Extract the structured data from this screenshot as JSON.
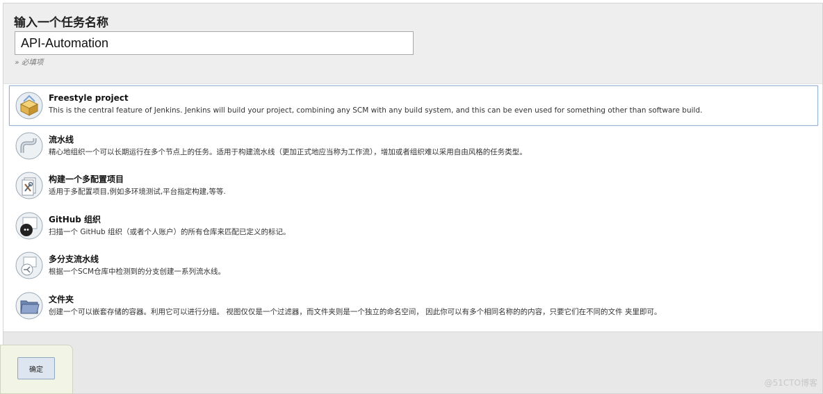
{
  "header": {
    "title": "输入一个任务名称",
    "input_value": "API-Automation",
    "required_hint": "» 必填项"
  },
  "items": [
    {
      "title": "Freestyle project",
      "description": "This is the central feature of Jenkins. Jenkins will build your project, combining any SCM with any build system, and this can be even used for something other than software build.",
      "icon": "freestyle-box-icon",
      "selected": true
    },
    {
      "title": "流水线",
      "description": "精心地组织一个可以长期运行在多个节点上的任务。适用于构建流水线（更加正式地应当称为工作流），增加或者组织难以采用自由风格的任务类型。",
      "icon": "pipeline-icon",
      "selected": false
    },
    {
      "title": "构建一个多配置项目",
      "description": "适用于多配置项目,例如多环境测试,平台指定构建,等等.",
      "icon": "multi-config-icon",
      "selected": false
    },
    {
      "title": "GitHub 组织",
      "description": "扫描一个 GitHub 组织（或者个人账户）的所有仓库来匹配已定义的标记。",
      "icon": "github-icon",
      "selected": false
    },
    {
      "title": "多分支流水线",
      "description": "根据一个SCM仓库中检测到的分支创建一系列流水线。",
      "icon": "multibranch-icon",
      "selected": false
    },
    {
      "title": "文件夹",
      "description": "创建一个可以嵌套存储的容器。利用它可以进行分组。 视图仅仅是一个过滤器，而文件夹则是一个独立的命名空间， 因此你可以有多个相同名称的的内容，只要它们在不同的文件 夹里即可。",
      "icon": "folder-icon",
      "selected": false
    }
  ],
  "footer": {
    "ok_label": "确定"
  },
  "watermark": "@51CTO博客"
}
